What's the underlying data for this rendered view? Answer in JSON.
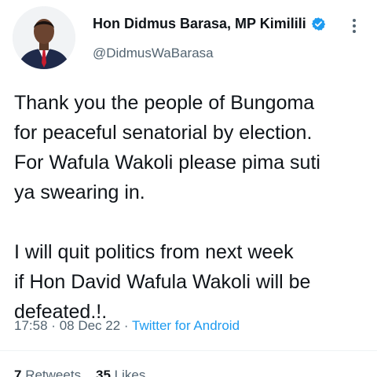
{
  "author": {
    "display_name": "Hon Didmus Barasa, MP Kimilili",
    "handle": "@DidmusWaBarasa",
    "avatar_icon": "profile-photo",
    "verified_icon": "verified-badge-icon",
    "verified_color": "#1d9bf0"
  },
  "tweet": {
    "text": "Thank you the people of Bungoma\nfor peaceful senatorial by election.\nFor Wafula Wakoli please pima suti\nya swearing in.\n\nI will quit politics from next week\nif Hon David Wafula Wakoli will be\ndefeated.!.",
    "time": "17:58",
    "date": "08 Dec 22",
    "separator": "·",
    "source": "Twitter for Android"
  },
  "stats": {
    "retweets_count": "7",
    "retweets_label": "Retweets",
    "likes_count": "35",
    "likes_label": "Likes"
  },
  "menu": {
    "more_icon": "more-vertical-icon"
  },
  "colors": {
    "link": "#1d9bf0",
    "secondary_text": "#536471",
    "primary_text": "#0f1419"
  }
}
